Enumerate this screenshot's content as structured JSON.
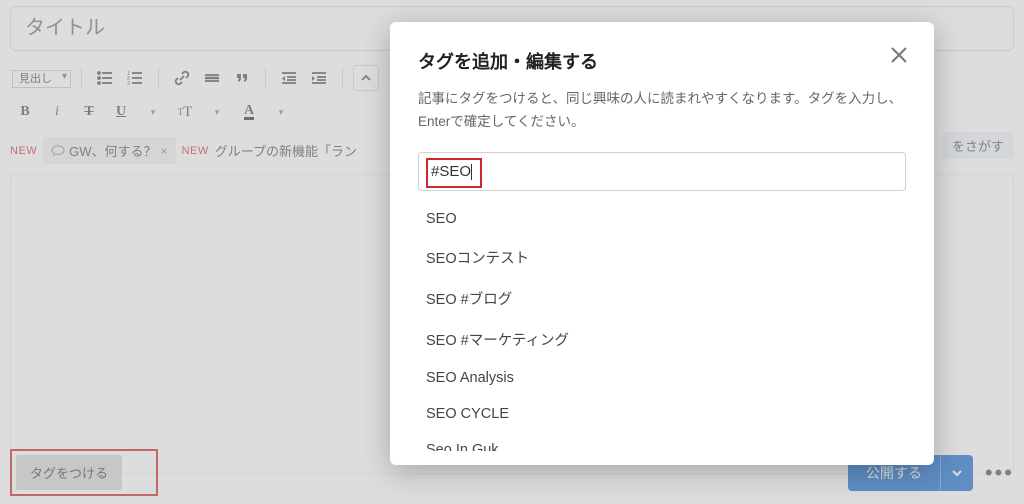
{
  "title_placeholder": "タイトル",
  "toolbar": {
    "heading_label": "見出し"
  },
  "suggestions": {
    "new_badge": "NEW",
    "chip1": "GW、何する？",
    "chip2_prefix": "グループの新機能「ラン"
  },
  "search_tags_label": "をさがす",
  "footer": {
    "tag_button": "タグをつける",
    "publish": "公開する"
  },
  "modal": {
    "title": "タグを追加・編集する",
    "description": "記事にタグをつけると、同じ興味の人に読まれやすくなります。タグを入力し、Enterで確定してください。",
    "input_value": "#SEO",
    "options": [
      "SEO",
      "SEOコンテスト",
      "SEO #ブログ",
      "SEO #マーケティング",
      "SEO Analysis",
      "SEO CYCLE",
      "Seo In Guk"
    ]
  }
}
